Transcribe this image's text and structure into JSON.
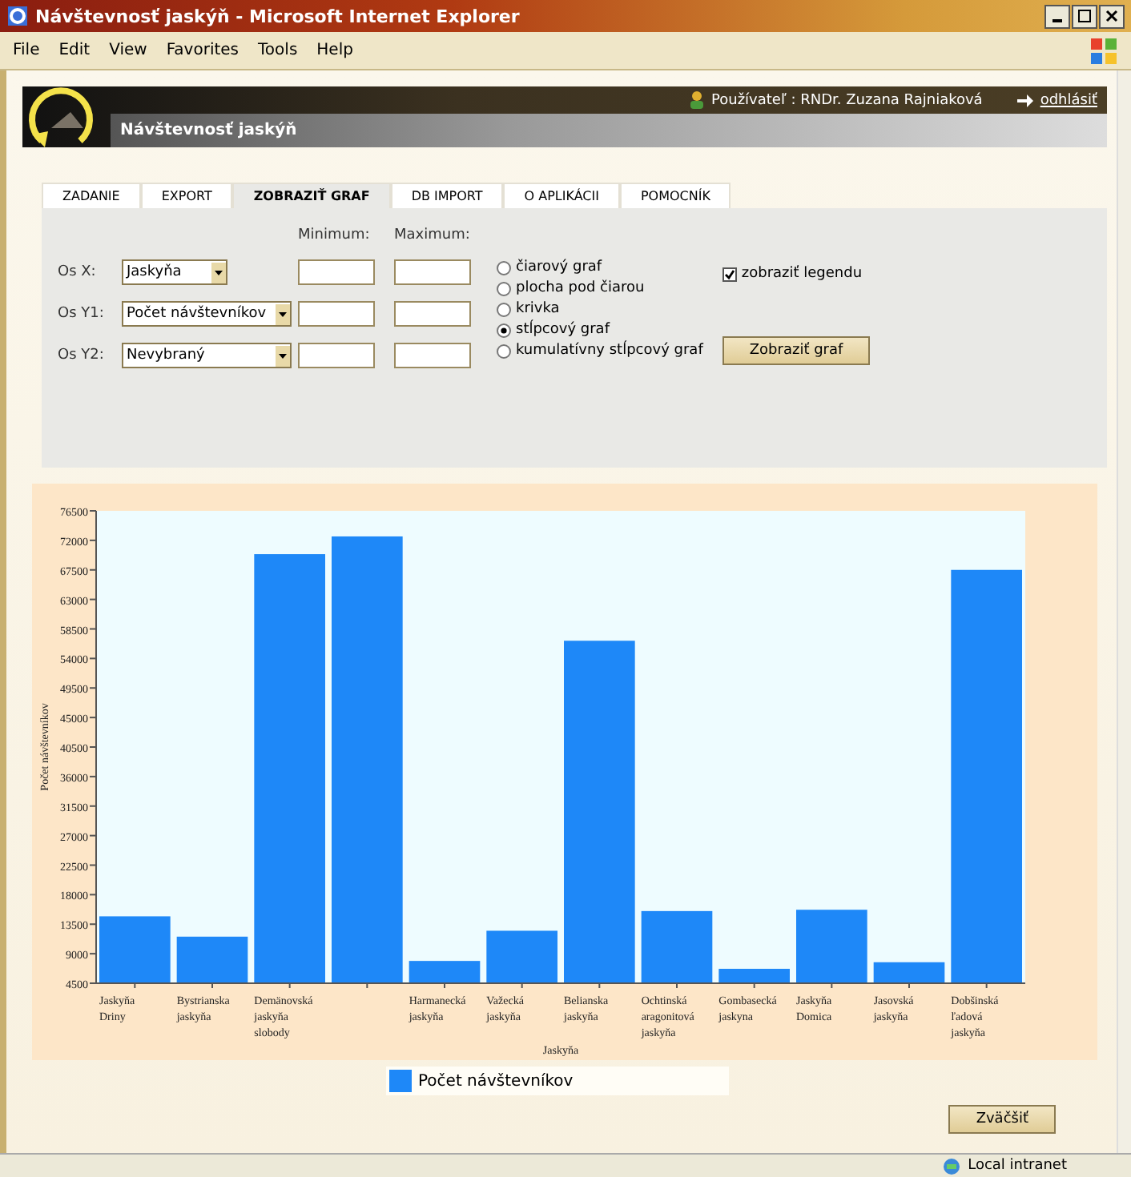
{
  "window": {
    "title": "Návštevnosť jaskýň - Microsoft Internet Explorer"
  },
  "menu": [
    "File",
    "Edit",
    "View",
    "Favorites",
    "Tools",
    "Help"
  ],
  "header": {
    "user_label": "Používateľ : RNDr. Zuzana Rajniaková",
    "logout": "odhlásiť",
    "subtitle": "Návštevnosť jaskýň"
  },
  "tabs": [
    {
      "label": "ZADANIE",
      "selected": false
    },
    {
      "label": "EXPORT",
      "selected": false
    },
    {
      "label": "ZOBRAZIŤ GRAF",
      "selected": true
    },
    {
      "label": "DB IMPORT",
      "selected": false
    },
    {
      "label": "O APLIKÁCII",
      "selected": false
    },
    {
      "label": "POMOCNÍK",
      "selected": false
    }
  ],
  "form": {
    "min_label": "Minimum:",
    "max_label": "Maximum:",
    "axes": [
      {
        "label": "Os X:",
        "value": "Jaskyňa"
      },
      {
        "label": "Os Y1:",
        "value": "Počet návštevníkov"
      },
      {
        "label": "Os Y2:",
        "value": "Nevybraný"
      }
    ],
    "chart_types": [
      {
        "label": "čiarový graf",
        "selected": false
      },
      {
        "label": "plocha pod čiarou",
        "selected": false
      },
      {
        "label": "krivka",
        "selected": false
      },
      {
        "label": "stĺpcový graf",
        "selected": true
      },
      {
        "label": "kumulatívny stĺpcový graf",
        "selected": false
      }
    ],
    "legend_checkbox": {
      "label": "zobraziť legendu",
      "checked": true
    },
    "submit": "Zobraziť graf"
  },
  "chart": {
    "chart_data": {
      "type": "bar",
      "xlabel": "Jaskyňa",
      "ylabel": "Počet návštevníkov",
      "categories": [
        "Jaskyňa Driny",
        "Bystrianska jaskyňa",
        "Demänovská jaskyňa slobody",
        null,
        "Harmanecká jaskyňa",
        "Važecká jaskyňa",
        "Belianska jaskyňa",
        "Ochtinská aragonitová jaskyňa",
        "Gombasecká jaskyna",
        "Jaskyňa Domica",
        "Jasovská jaskyňa",
        "Dobšinská ľadová jaskyňa"
      ],
      "series": [
        {
          "name": "Počet návštevníkov",
          "color": "#1e88f8",
          "values": [
            14700,
            11600,
            69900,
            72600,
            7900,
            12500,
            56700,
            15500,
            6700,
            15700,
            7700,
            67500
          ]
        }
      ],
      "ylim": [
        4500,
        76500
      ],
      "yticks": [
        4500,
        9000,
        13500,
        18000,
        22500,
        27000,
        31500,
        36000,
        40500,
        45000,
        49500,
        54000,
        58500,
        63000,
        67500,
        72000,
        76500
      ]
    },
    "zoom_button": "Zväčšiť"
  },
  "status_bar": {
    "zone": "Local intranet"
  }
}
